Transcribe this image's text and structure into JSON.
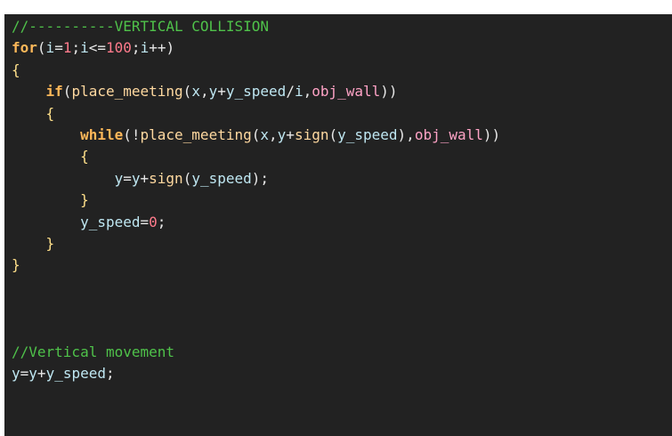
{
  "editor": {
    "lines": [
      [
        [
          "//----------VERTICAL COLLISION",
          "c-comment"
        ]
      ],
      [
        [
          "for",
          "c-keyword"
        ],
        [
          "(",
          "c-punc"
        ],
        [
          "i",
          "c-ident"
        ],
        [
          "=",
          "c-punc"
        ],
        [
          "1",
          "c-number"
        ],
        [
          ";",
          "c-punc"
        ],
        [
          "i",
          "c-ident"
        ],
        [
          "<=",
          "c-punc"
        ],
        [
          "100",
          "c-number"
        ],
        [
          ";",
          "c-punc"
        ],
        [
          "i",
          "c-ident"
        ],
        [
          "++)",
          "c-punc"
        ]
      ],
      [
        [
          "{",
          "c-brace"
        ]
      ],
      [
        [
          "    ",
          "c-punc"
        ],
        [
          "if",
          "c-keyword"
        ],
        [
          "(",
          "c-punc"
        ],
        [
          "place_meeting",
          "c-func"
        ],
        [
          "(",
          "c-punc"
        ],
        [
          "x",
          "c-ident"
        ],
        [
          ",",
          "c-punc"
        ],
        [
          "y",
          "c-ident"
        ],
        [
          "+",
          "c-punc"
        ],
        [
          "y_speed",
          "c-ident"
        ],
        [
          "/",
          "c-punc"
        ],
        [
          "i",
          "c-ident"
        ],
        [
          ",",
          "c-punc"
        ],
        [
          "obj_wall",
          "c-obj"
        ],
        [
          "))",
          "c-punc"
        ]
      ],
      [
        [
          "    ",
          "c-punc"
        ],
        [
          "{",
          "c-brace"
        ]
      ],
      [
        [
          "        ",
          "c-punc"
        ],
        [
          "while",
          "c-keyword"
        ],
        [
          "(!",
          "c-punc"
        ],
        [
          "place_meeting",
          "c-func"
        ],
        [
          "(",
          "c-punc"
        ],
        [
          "x",
          "c-ident"
        ],
        [
          ",",
          "c-punc"
        ],
        [
          "y",
          "c-ident"
        ],
        [
          "+",
          "c-punc"
        ],
        [
          "sign",
          "c-func"
        ],
        [
          "(",
          "c-punc"
        ],
        [
          "y_speed",
          "c-ident"
        ],
        [
          "),",
          "c-punc"
        ],
        [
          "obj_wall",
          "c-obj"
        ],
        [
          "))",
          "c-punc"
        ]
      ],
      [
        [
          "        ",
          "c-punc"
        ],
        [
          "{",
          "c-brace"
        ]
      ],
      [
        [
          "            ",
          "c-punc"
        ],
        [
          "y",
          "c-ident"
        ],
        [
          "=",
          "c-punc"
        ],
        [
          "y",
          "c-ident"
        ],
        [
          "+",
          "c-punc"
        ],
        [
          "sign",
          "c-func"
        ],
        [
          "(",
          "c-punc"
        ],
        [
          "y_speed",
          "c-ident"
        ],
        [
          ");",
          "c-punc"
        ]
      ],
      [
        [
          "        ",
          "c-punc"
        ],
        [
          "}",
          "c-brace"
        ]
      ],
      [
        [
          "        ",
          "c-punc"
        ],
        [
          "y_speed",
          "c-ident"
        ],
        [
          "=",
          "c-punc"
        ],
        [
          "0",
          "c-number"
        ],
        [
          ";",
          "c-punc"
        ]
      ],
      [
        [
          "    ",
          "c-punc"
        ],
        [
          "}",
          "c-brace"
        ]
      ],
      [
        [
          "}",
          "c-brace"
        ]
      ],
      [],
      [],
      [],
      [
        [
          "//Vertical movement",
          "c-comment"
        ]
      ],
      [
        [
          "y",
          "c-ident"
        ],
        [
          "=",
          "c-punc"
        ],
        [
          "y",
          "c-ident"
        ],
        [
          "+",
          "c-punc"
        ],
        [
          "y_speed",
          "c-ident"
        ],
        [
          ";",
          "c-punc"
        ]
      ]
    ]
  },
  "colors": {
    "background": "#222222",
    "comment": "#4fc24a",
    "keyword": "#ffb859",
    "number": "#ff7b8c",
    "function": "#ffd9a0",
    "object": "#ffa3c6",
    "identifier": "#bfe7f2",
    "punctuation": "#e8e8e8",
    "brace": "#ffe08a"
  }
}
